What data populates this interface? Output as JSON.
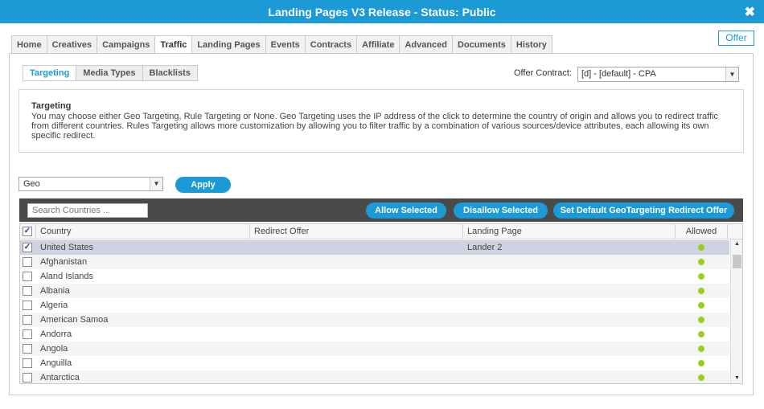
{
  "window": {
    "title": "Landing Pages V3 Release - Status: Public",
    "close_icon": "✖"
  },
  "offer_button": "Offer",
  "tabs": [
    {
      "label": "Home",
      "active": false
    },
    {
      "label": "Creatives",
      "active": false
    },
    {
      "label": "Campaigns",
      "active": false
    },
    {
      "label": "Traffic",
      "active": true
    },
    {
      "label": "Landing Pages",
      "active": false
    },
    {
      "label": "Events",
      "active": false
    },
    {
      "label": "Contracts",
      "active": false
    },
    {
      "label": "Affiliate",
      "active": false
    },
    {
      "label": "Advanced",
      "active": false
    },
    {
      "label": "Documents",
      "active": false
    },
    {
      "label": "History",
      "active": false
    }
  ],
  "subtabs": [
    {
      "label": "Targeting",
      "active": true
    },
    {
      "label": "Media Types",
      "active": false
    },
    {
      "label": "Blacklists",
      "active": false
    }
  ],
  "offer_contract": {
    "label": "Offer Contract:",
    "value": "[d] - [default] - CPA"
  },
  "info": {
    "heading": "Targeting",
    "body": "You may choose either Geo Targeting, Rule Targeting or None. Geo Targeting uses the IP address of the click to determine the country of origin and allows you to redirect traffic from different countries. Rules Targeting allows more customization by allowing you to filter traffic by a combination of various sources/device attributes, each allowing its own specific redirect."
  },
  "targeting_type": {
    "value": "Geo"
  },
  "apply_button": "Apply",
  "search": {
    "placeholder": "Search Countries ..."
  },
  "actions": {
    "allow": "Allow Selected",
    "disallow": "Disallow Selected",
    "set_default": "Set Default GeoTargeting Redirect Offer"
  },
  "colors": {
    "accent": "#1b9ad6",
    "allowed": "#9acd1f",
    "toolbar": "#4a4a4a",
    "selected_row": "#cfd2e3"
  },
  "grid": {
    "header_checked": true,
    "columns": {
      "country": "Country",
      "redirect": "Redirect Offer",
      "landing": "Landing Page",
      "allowed": "Allowed"
    },
    "rows": [
      {
        "country": "United States",
        "redirect": "",
        "landing": "Lander 2",
        "checked": true
      },
      {
        "country": "Afghanistan",
        "redirect": "",
        "landing": "",
        "checked": false
      },
      {
        "country": "Aland Islands",
        "redirect": "",
        "landing": "",
        "checked": false
      },
      {
        "country": "Albania",
        "redirect": "",
        "landing": "",
        "checked": false
      },
      {
        "country": "Algeria",
        "redirect": "",
        "landing": "",
        "checked": false
      },
      {
        "country": "American Samoa",
        "redirect": "",
        "landing": "",
        "checked": false
      },
      {
        "country": "Andorra",
        "redirect": "",
        "landing": "",
        "checked": false
      },
      {
        "country": "Angola",
        "redirect": "",
        "landing": "",
        "checked": false
      },
      {
        "country": "Anguilla",
        "redirect": "",
        "landing": "",
        "checked": false
      },
      {
        "country": "Antarctica",
        "redirect": "",
        "landing": "",
        "checked": false
      }
    ]
  }
}
